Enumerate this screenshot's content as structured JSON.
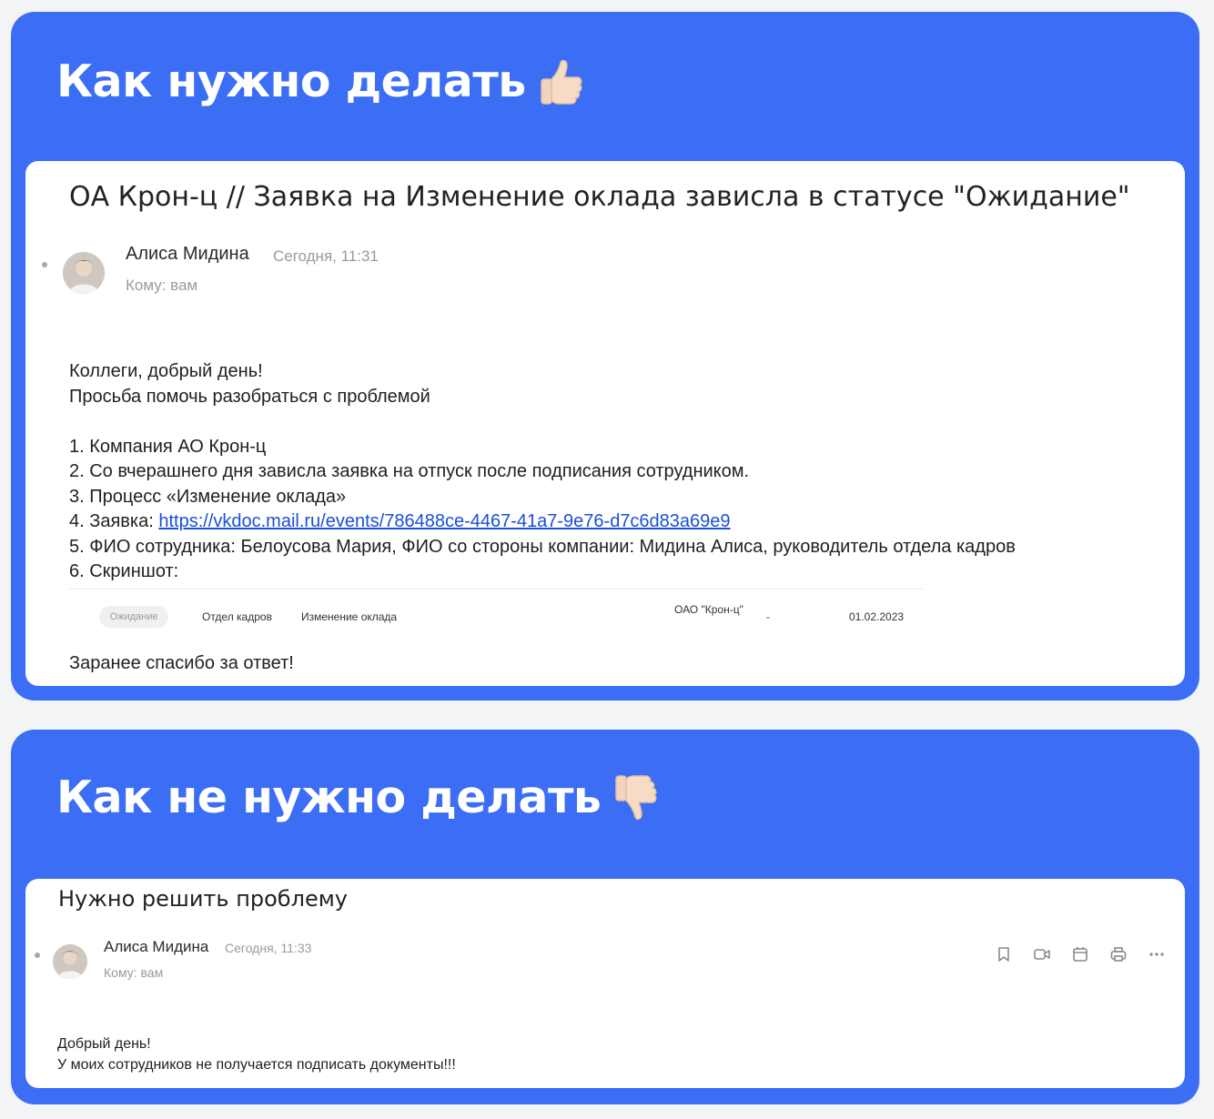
{
  "good": {
    "heading": "Как нужно делать",
    "heading_icon": "thumbs-up-icon",
    "subject": "ОА Крон-ц // Заявка на Изменение оклада зависла в статусе \"Ожидание\"",
    "sender": "Алиса Мидина",
    "date": "Сегодня, 11:31",
    "to": "Кому: вам",
    "lines": [
      "Коллеги, добрый день!",
      "Просьба помочь разобраться с проблемой",
      "",
      "1. Компания АО Крон-ц",
      "2. Со вчерашнего дня зависла заявка на отпуск после подписания сотрудником.",
      "3. Процесс «Изменение оклада»",
      "4. Заявка: ",
      "5. ФИО сотрудника: Белоусова Мария, ФИО со стороны компании: Мидина Алиса, руководитель отдела кадров",
      "6. Скриншот:"
    ],
    "link": "https://vkdoc.mail.ru/events/786488ce-4467-41a7-9e76-d7c6d83a69e9",
    "screenshot_row": {
      "status": "Ожидание",
      "department": "Отдел кадров",
      "process": "Изменение оклада",
      "company": "ОАО \"Крон-ц\"",
      "dash": "-",
      "date": "01.02.2023"
    },
    "closing": "Заранее спасибо за ответ!"
  },
  "bad": {
    "heading": "Как не нужно делать",
    "heading_icon": "thumbs-down-icon",
    "subject": "Нужно решить проблему",
    "sender": "Алиса Мидина",
    "date": "Сегодня, 11:33",
    "to": "Кому: вам",
    "lines": [
      "Добрый день!",
      "У моих сотрудников не получается подписать документы!!!"
    ],
    "actions": [
      "bookmark-icon",
      "video-call-icon",
      "calendar-icon",
      "print-icon",
      "more-icon"
    ]
  },
  "colors": {
    "accent": "#3b6ef5",
    "link": "#1a4fd6",
    "muted": "#9a9a9a"
  }
}
